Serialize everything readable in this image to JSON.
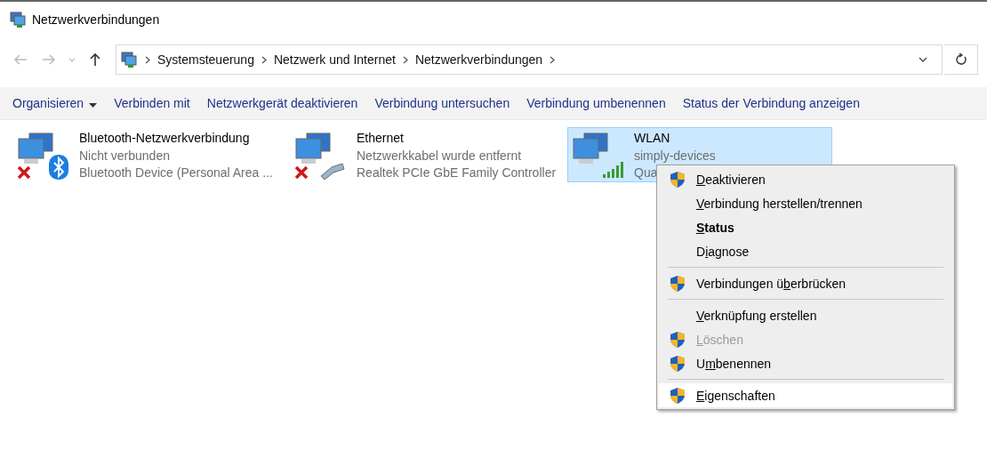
{
  "window": {
    "title": "Netzwerkverbindungen"
  },
  "address_bar": {
    "path": [
      "Systemsteuerung",
      "Netzwerk und Internet",
      "Netzwerkverbindungen"
    ]
  },
  "toolbar": [
    {
      "label": "Organisieren",
      "dropdown": true
    },
    {
      "label": "Verbinden mit",
      "dropdown": false
    },
    {
      "label": "Netzwerkgerät deaktivieren",
      "dropdown": false
    },
    {
      "label": "Verbindung untersuchen",
      "dropdown": false
    },
    {
      "label": "Verbindung umbenennen",
      "dropdown": false
    },
    {
      "label": "Status der Verbindung anzeigen",
      "dropdown": false
    }
  ],
  "connections": [
    {
      "name": "Bluetooth-Netzwerkverbindung",
      "status": "Nicht verbunden",
      "device": "Bluetooth Device (Personal Area ...",
      "kind": "bluetooth",
      "disconnected": true,
      "selected": false
    },
    {
      "name": "Ethernet",
      "status": "Netzwerkkabel wurde entfernt",
      "device": "Realtek PCIe GbE Family Controller",
      "kind": "ethernet",
      "disconnected": true,
      "selected": false
    },
    {
      "name": "WLAN",
      "status": "simply-devices",
      "device": "Qua",
      "kind": "wifi",
      "disconnected": false,
      "selected": true
    }
  ],
  "context_menu": [
    {
      "kind": "item",
      "key": "D",
      "post": "eaktivieren",
      "shield": true,
      "bold": false,
      "disabled": false,
      "selected": false
    },
    {
      "kind": "item",
      "key": "V",
      "post": "erbindung herstellen/trennen",
      "shield": false,
      "bold": false,
      "disabled": false,
      "selected": false
    },
    {
      "kind": "item",
      "key": "S",
      "post": "tatus",
      "shield": false,
      "bold": true,
      "disabled": false,
      "selected": false
    },
    {
      "kind": "item",
      "pre": "D",
      "key": "i",
      "post": "agnose",
      "shield": false,
      "bold": false,
      "disabled": false,
      "selected": false
    },
    {
      "kind": "separator"
    },
    {
      "kind": "item",
      "pre": "Verbindungen ü",
      "key": "b",
      "post": "erbrücken",
      "shield": true,
      "bold": false,
      "disabled": false,
      "selected": false
    },
    {
      "kind": "separator"
    },
    {
      "kind": "item",
      "key": "V",
      "post": "erknüpfung erstellen",
      "shield": false,
      "bold": false,
      "disabled": false,
      "selected": false
    },
    {
      "kind": "item",
      "key": "L",
      "post": "öschen",
      "shield": true,
      "bold": false,
      "disabled": true,
      "selected": false
    },
    {
      "kind": "item",
      "pre": "U",
      "key": "m",
      "post": "benennen",
      "shield": true,
      "bold": false,
      "disabled": false,
      "selected": false
    },
    {
      "kind": "separator"
    },
    {
      "kind": "item",
      "key": "E",
      "post": "igenschaften",
      "shield": true,
      "bold": false,
      "disabled": false,
      "selected": true
    }
  ]
}
